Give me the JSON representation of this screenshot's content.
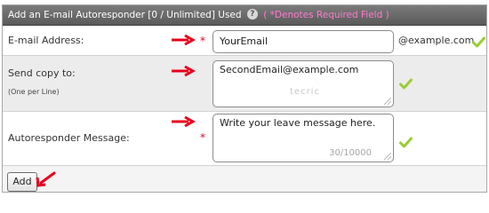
{
  "header": {
    "title": "Add an E-mail Autoresponder [0 / Unlimited] Used",
    "help_icon_label": "?",
    "required_note": "( *Denotes Required Field )"
  },
  "form": {
    "email": {
      "label": "E-mail Address:",
      "required_marker": "*",
      "value": "YourEmail",
      "domain_suffix": "@example.com"
    },
    "send_copy": {
      "label": "Send copy to:",
      "hint": "(One per Line)",
      "value": "SecondEmail@example.com",
      "watermark": "tecric"
    },
    "message": {
      "label": "Autoresponder Message:",
      "required_marker": "*",
      "value": "Write your leave message here.",
      "counter": "30/10000"
    }
  },
  "actions": {
    "add_label": "Add"
  },
  "icons": {
    "help": "help-icon",
    "arrow": "red-arrow-icon",
    "check": "green-checkmark-icon"
  },
  "colors": {
    "header_bg": "#666666",
    "required_note": "#ff7ad0",
    "required_star": "#e2002a",
    "arrow": "#e8001c",
    "check": "#9acd32"
  }
}
